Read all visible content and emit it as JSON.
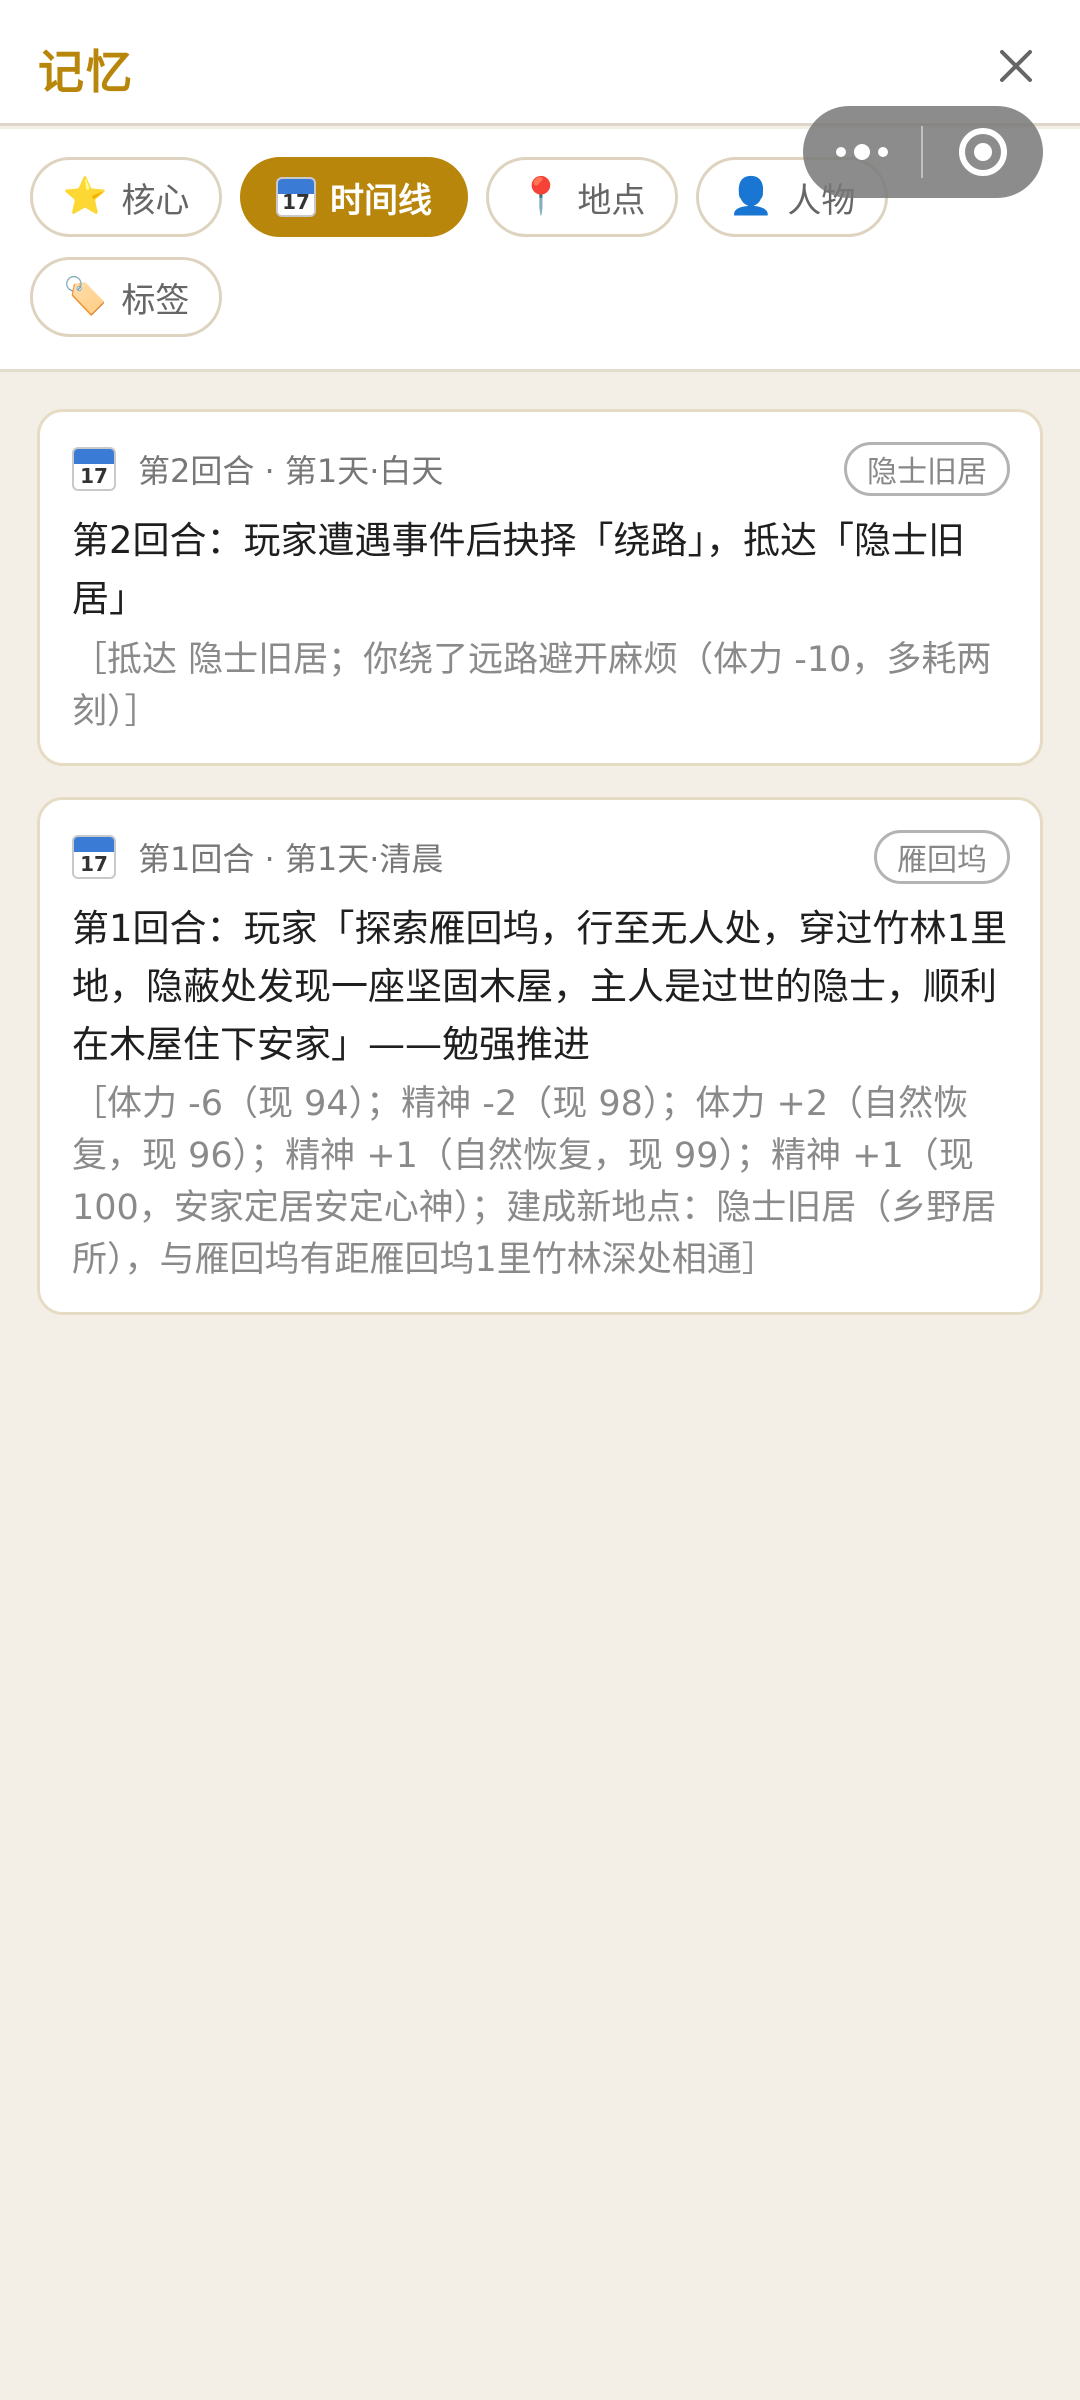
{
  "header": {
    "title": "记忆"
  },
  "tabs": [
    {
      "label": "核心",
      "icon": "star-icon",
      "glyph": "⭐"
    },
    {
      "label": "时间线",
      "icon": "calendar-icon",
      "active": true
    },
    {
      "label": "地点",
      "icon": "pin-icon",
      "glyph": "📍"
    },
    {
      "label": "人物",
      "icon": "person-icon",
      "glyph": "👤"
    },
    {
      "label": "标签",
      "icon": "tag-icon",
      "glyph": "🏷️"
    }
  ],
  "calendar_icon": {
    "day": "17"
  },
  "entries": [
    {
      "meta": "第2回合 · 第1天·白天",
      "location": "隐士旧居",
      "title": "第2回合：玩家遭遇事件后抉择「绕路」，抵达「隐士旧居」",
      "detail": "［抵达 隐士旧居；你绕了远路避开麻烦（体力 -10，多耗两刻）］"
    },
    {
      "meta": "第1回合 · 第1天·清晨",
      "location": "雁回坞",
      "title": "第1回合：玩家「探索雁回坞，行至无人处，穿过竹林1里地，隐蔽处发现一座坚固木屋，主人是过世的隐士，顺利在木屋住下安家」——勉强推进",
      "detail": "［体力 -6（现 94）；精神 -2（现 98）；体力 +2（自然恢复，现 96）；精神 +1（自然恢复，现 99）；精神 +1（现 100，安家定居安定心神）；建成新地点：隐士旧居（乡野居所），与雁回坞有距雁回坞1里竹林深处相通］"
    }
  ],
  "colors": {
    "accent": "#b8860b",
    "background": "#f3efe7"
  }
}
